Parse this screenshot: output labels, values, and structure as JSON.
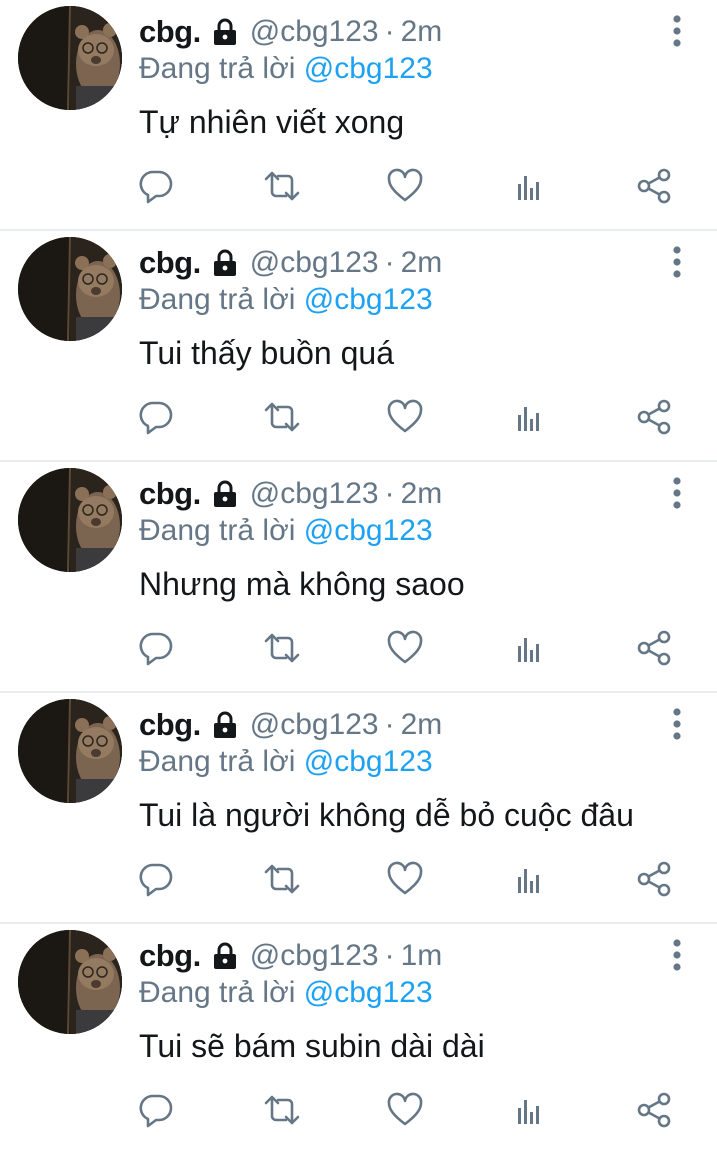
{
  "colors": {
    "text_primary": "#14171a",
    "text_secondary": "#657786",
    "accent": "#1da1f2",
    "divider": "#e6ecf0"
  },
  "icons": {
    "lock": "lock-icon",
    "more": "more-vertical-icon",
    "reply": "reply-icon",
    "retweet": "retweet-icon",
    "like": "heart-icon",
    "analytics": "analytics-icon",
    "share": "share-icon"
  },
  "tweets": [
    {
      "display_name": "cbg.",
      "handle": "@cbg123",
      "separator": "·",
      "time": "2m",
      "reply_prefix": "Đang trả lời",
      "reply_to": "@cbg123",
      "text": "Tự nhiên viết xong"
    },
    {
      "display_name": "cbg.",
      "handle": "@cbg123",
      "separator": "·",
      "time": "2m",
      "reply_prefix": "Đang trả lời",
      "reply_to": "@cbg123",
      "text": "Tui thấy buồn quá"
    },
    {
      "display_name": "cbg.",
      "handle": "@cbg123",
      "separator": "·",
      "time": "2m",
      "reply_prefix": "Đang trả lời",
      "reply_to": "@cbg123",
      "text": "Nhưng mà không saoo"
    },
    {
      "display_name": "cbg.",
      "handle": "@cbg123",
      "separator": "·",
      "time": "2m",
      "reply_prefix": "Đang trả lời",
      "reply_to": "@cbg123",
      "text": "Tui là người không dễ bỏ cuộc đâu"
    },
    {
      "display_name": "cbg.",
      "handle": "@cbg123",
      "separator": "·",
      "time": "1m",
      "reply_prefix": "Đang trả lời",
      "reply_to": "@cbg123",
      "text": "Tui sẽ bám subin dài dài"
    }
  ]
}
